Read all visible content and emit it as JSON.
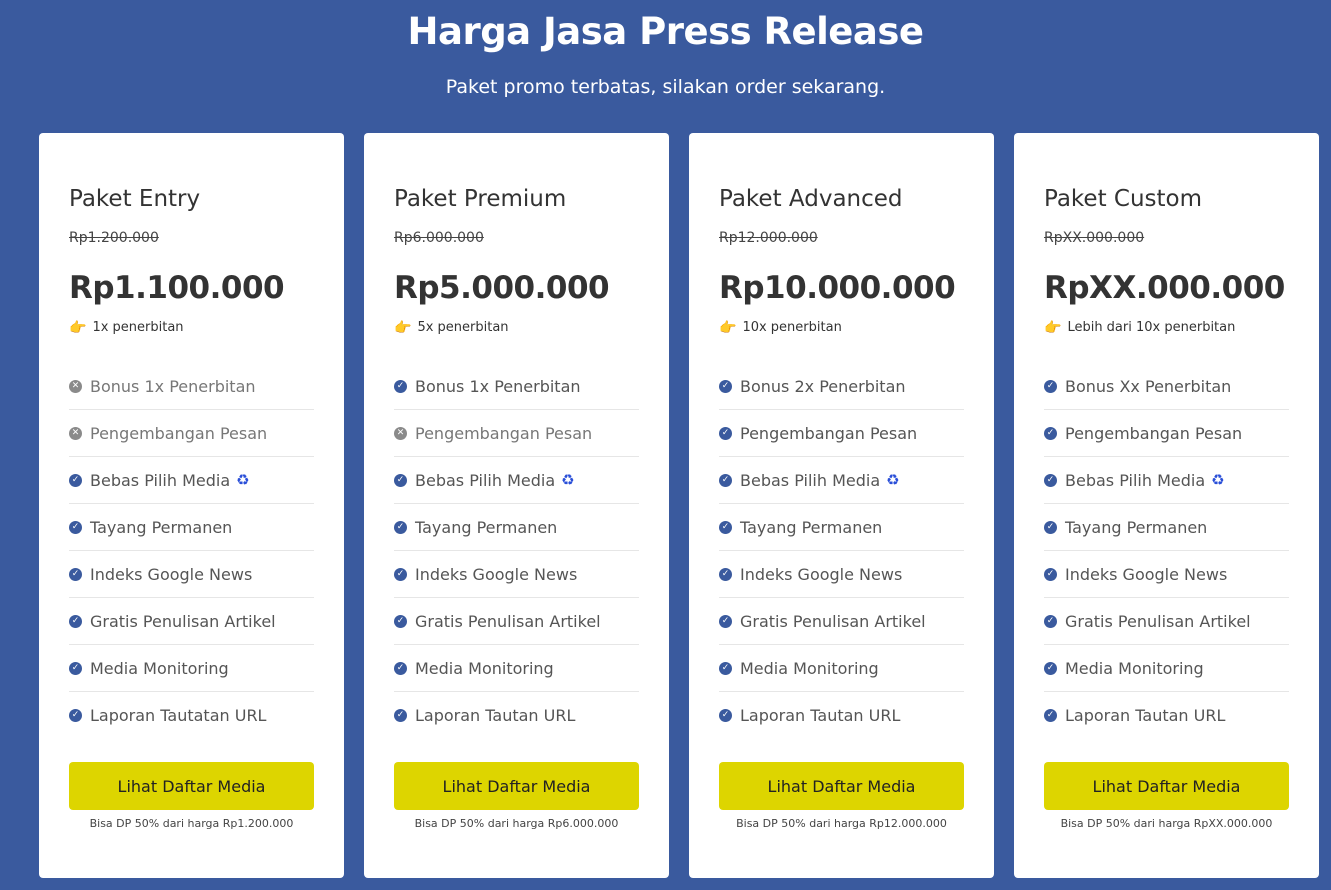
{
  "header": {
    "title": "Harga Jasa Press Release",
    "subtitle": "Paket promo terbatas, silakan order sekarang."
  },
  "colors": {
    "background": "#3a5a9e",
    "button": "#ddd500",
    "check": "#3a5a9e",
    "cross": "#8a8a8a"
  },
  "cards": [
    {
      "name": "Paket Entry",
      "old_price": "Rp1.200.000",
      "price": "Rp1.100.000",
      "publications": "1x penerbitan",
      "features": [
        {
          "label": "Bonus 1x Penerbitan",
          "included": false
        },
        {
          "label": "Pengembangan Pesan",
          "included": false
        },
        {
          "label": "Bebas Pilih Media",
          "included": true,
          "icon": "recycle-icon"
        },
        {
          "label": "Tayang Permanen",
          "included": true
        },
        {
          "label": "Indeks Google News",
          "included": true
        },
        {
          "label": "Gratis Penulisan Artikel",
          "included": true
        },
        {
          "label": "Media Monitoring",
          "included": true
        },
        {
          "label": "Laporan Tautatan URL",
          "included": true
        }
      ],
      "button": "Lihat Daftar Media",
      "dp_note": "Bisa DP 50% dari harga Rp1.200.000"
    },
    {
      "name": "Paket Premium",
      "old_price": "Rp6.000.000",
      "price": "Rp5.000.000",
      "publications": "5x penerbitan",
      "features": [
        {
          "label": "Bonus 1x Penerbitan",
          "included": true
        },
        {
          "label": "Pengembangan Pesan",
          "included": false
        },
        {
          "label": "Bebas Pilih Media",
          "included": true,
          "icon": "recycle-icon"
        },
        {
          "label": "Tayang Permanen",
          "included": true
        },
        {
          "label": "Indeks Google News",
          "included": true
        },
        {
          "label": "Gratis Penulisan Artikel",
          "included": true
        },
        {
          "label": "Media Monitoring",
          "included": true
        },
        {
          "label": "Laporan Tautan URL",
          "included": true
        }
      ],
      "button": "Lihat Daftar Media",
      "dp_note": "Bisa DP 50% dari harga Rp6.000.000"
    },
    {
      "name": "Paket Advanced",
      "old_price": "Rp12.000.000",
      "price": "Rp10.000.000",
      "publications": "10x penerbitan",
      "features": [
        {
          "label": "Bonus 2x Penerbitan",
          "included": true
        },
        {
          "label": "Pengembangan Pesan",
          "included": true
        },
        {
          "label": "Bebas Pilih Media",
          "included": true,
          "icon": "recycle-icon"
        },
        {
          "label": "Tayang Permanen",
          "included": true
        },
        {
          "label": "Indeks Google News",
          "included": true
        },
        {
          "label": "Gratis Penulisan Artikel",
          "included": true
        },
        {
          "label": "Media Monitoring",
          "included": true
        },
        {
          "label": "Laporan Tautan URL",
          "included": true
        }
      ],
      "button": "Lihat Daftar Media",
      "dp_note": "Bisa DP 50% dari harga Rp12.000.000"
    },
    {
      "name": "Paket Custom",
      "old_price": "RpXX.000.000",
      "price": "RpXX.000.000",
      "publications": "Lebih dari 10x penerbitan",
      "features": [
        {
          "label": "Bonus Xx Penerbitan",
          "included": true
        },
        {
          "label": "Pengembangan Pesan",
          "included": true
        },
        {
          "label": "Bebas Pilih Media",
          "included": true,
          "icon": "recycle-icon"
        },
        {
          "label": "Tayang Permanen",
          "included": true
        },
        {
          "label": "Indeks Google News",
          "included": true
        },
        {
          "label": "Gratis Penulisan Artikel",
          "included": true
        },
        {
          "label": "Media Monitoring",
          "included": true
        },
        {
          "label": "Laporan Tautan URL",
          "included": true
        }
      ],
      "button": "Lihat Daftar Media",
      "dp_note": "Bisa DP 50% dari harga RpXX.000.000"
    }
  ]
}
